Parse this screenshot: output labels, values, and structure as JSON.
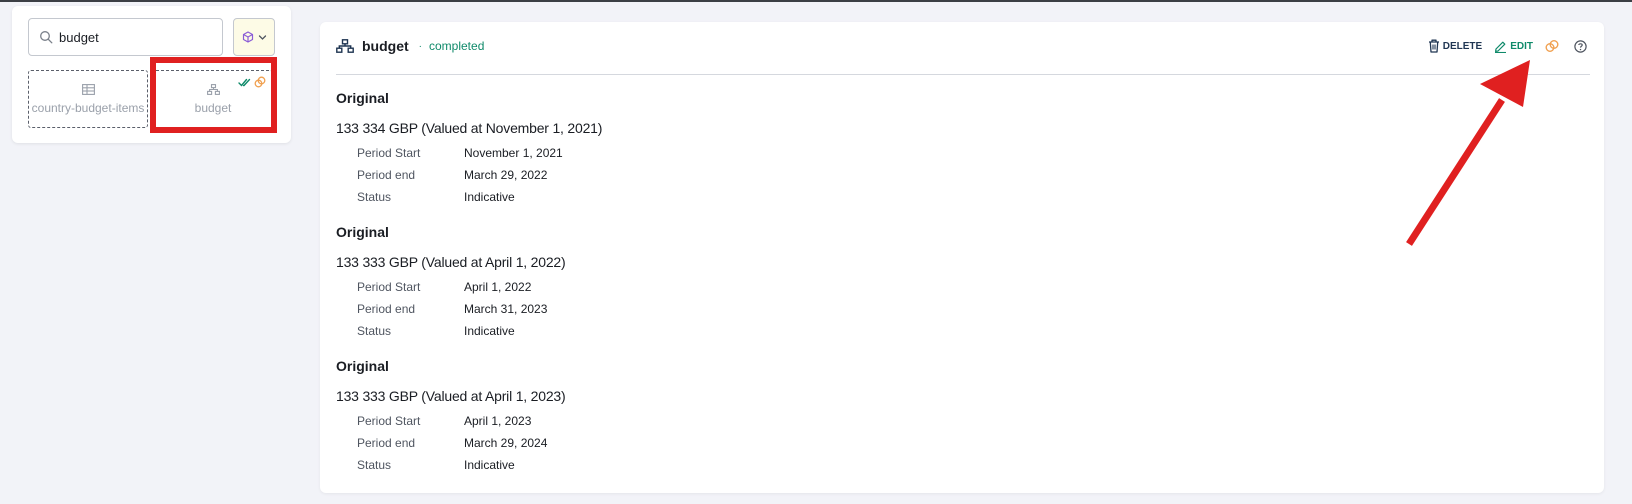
{
  "search": {
    "value": "budget",
    "placeholder": ""
  },
  "elements": [
    {
      "label": "country-budget-items"
    },
    {
      "label": "budget"
    }
  ],
  "detail": {
    "title": "budget",
    "separator": "·",
    "status": "completed",
    "delete_label": "DELETE",
    "edit_label": "EDIT",
    "budgets": [
      {
        "type": "Original",
        "value": "133 334 GBP (Valued at November 1, 2021)",
        "rows": [
          {
            "label": "Period Start",
            "value": "November 1, 2021"
          },
          {
            "label": "Period end",
            "value": "March 29, 2022"
          },
          {
            "label": "Status",
            "value": "Indicative"
          }
        ]
      },
      {
        "type": "Original",
        "value": "133 333 GBP (Valued at April 1, 2022)",
        "rows": [
          {
            "label": "Period Start",
            "value": "April 1, 2022"
          },
          {
            "label": "Period end",
            "value": "March 31, 2023"
          },
          {
            "label": "Status",
            "value": "Indicative"
          }
        ]
      },
      {
        "type": "Original",
        "value": "133 333 GBP (Valued at April 1, 2023)",
        "rows": [
          {
            "label": "Period Start",
            "value": "April 1, 2023"
          },
          {
            "label": "Period end",
            "value": "March 29, 2024"
          },
          {
            "label": "Status",
            "value": "Indicative"
          }
        ]
      }
    ]
  },
  "colors": {
    "accent_green": "#0f8a6a",
    "highlight_red": "#e02020",
    "linked_orange": "#f0a050",
    "filter_purple": "#8a5cd6"
  },
  "icons": [
    "search-icon",
    "cube-icon",
    "chevron-down-icon",
    "table-icon",
    "hierarchy-icon",
    "double-check-icon",
    "link-icon",
    "trash-icon",
    "pencil-icon",
    "help-icon"
  ]
}
